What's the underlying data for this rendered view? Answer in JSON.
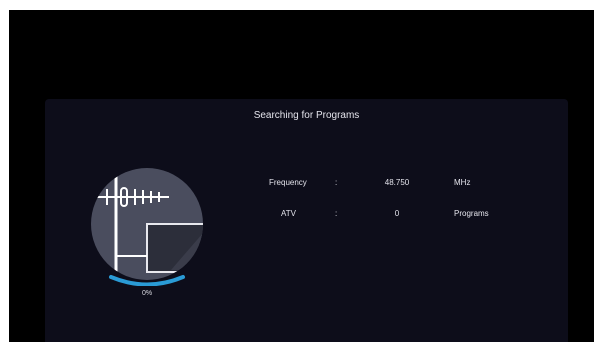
{
  "dialog": {
    "title": "Searching for Programs"
  },
  "progress": {
    "label": "0%",
    "value": 0
  },
  "rows": [
    {
      "label": "Frequency",
      "separator": ":",
      "value": "48.750",
      "unit": "MHz"
    },
    {
      "label": "ATV",
      "separator": ":",
      "value": "0",
      "unit": "Programs"
    }
  ],
  "icons": {
    "antenna": "antenna-tv-icon"
  },
  "colors": {
    "screen": "#000000",
    "dialog": "#0d0d1a",
    "circle": "#4a4d5e",
    "progress_arc": "#2a9bd6",
    "text": "#e4e4ec"
  }
}
